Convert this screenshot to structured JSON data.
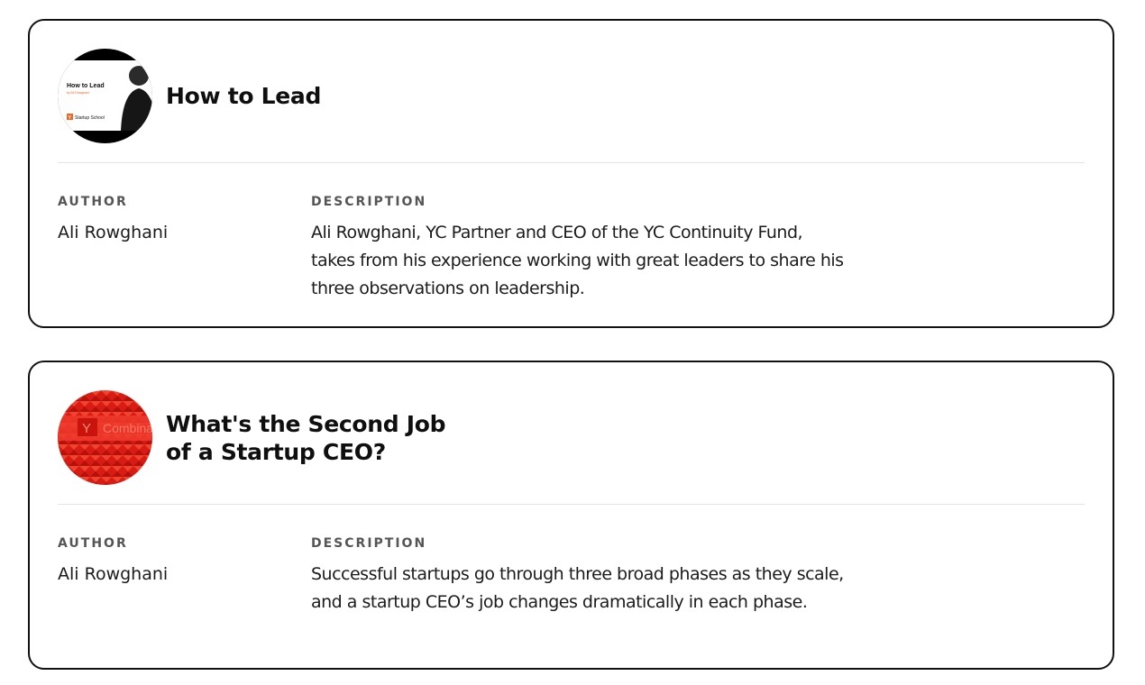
{
  "cards": [
    {
      "title": "How to Lead",
      "thumbnail": {
        "icon": "video-thumbnail-how-to-lead",
        "title_text": "How to Lead",
        "byline": "by Ali Rowghani",
        "logo_letter": "Y",
        "logo_text": "Startup School",
        "accent": "#f26522"
      },
      "author_label": "AUTHOR",
      "author": "Ali Rowghani",
      "description_label": "DESCRIPTION",
      "description": "Ali Rowghani, YC Partner and CEO of the YC Continuity Fund, takes from his experience working with great leaders to share his three observations on leadership."
    },
    {
      "title": "What's the Second Job of a Startup CEO?",
      "thumbnail": {
        "icon": "video-thumbnail-y-combinator-sign",
        "logo_letter": "Y",
        "logo_text": "Combina",
        "tint": "#e0231a"
      },
      "author_label": "AUTHOR",
      "author": "Ali Rowghani",
      "description_label": "DESCRIPTION",
      "description": "Successful startups go through three broad phases as they scale, and a startup CEO’s job changes dramatically in each phase."
    }
  ]
}
